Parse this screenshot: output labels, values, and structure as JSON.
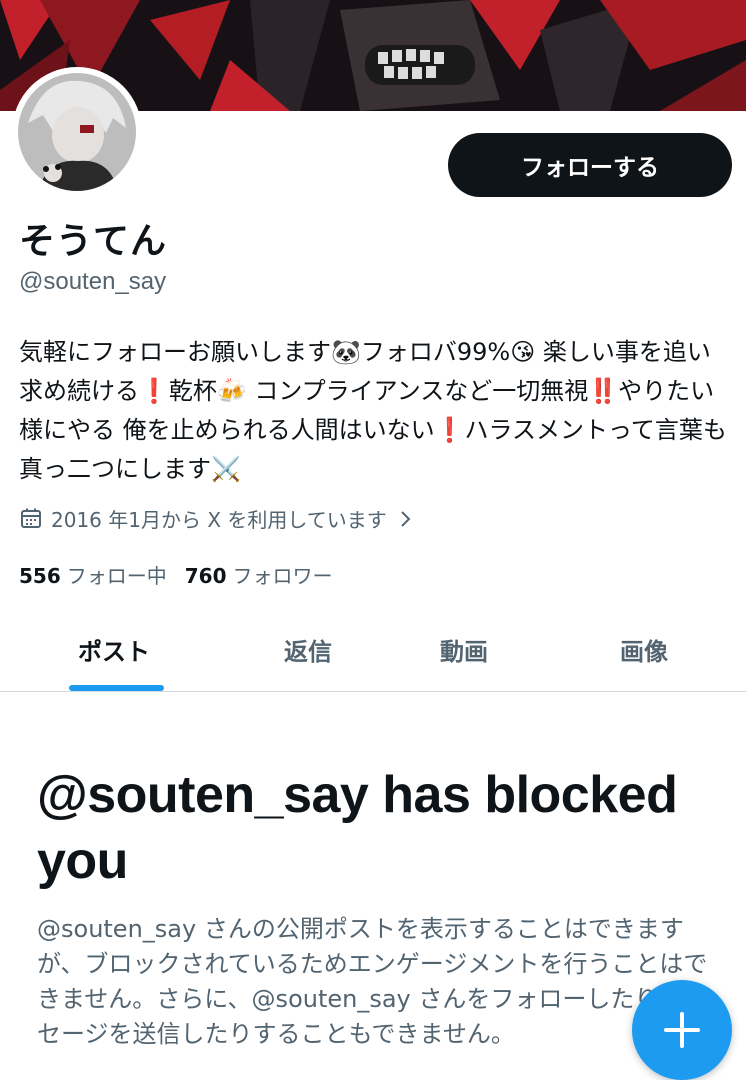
{
  "profile": {
    "display_name": "そうてん",
    "handle": "@souten_say",
    "follow_button_label": "フォローする",
    "bio": "気軽にフォローお願いします🐼フォロバ99%😘 楽しい事を追い求め続ける❗️乾杯🍻 コンプライアンスなど一切無視‼️やりたい様にやる 俺を止められる人間はいない❗️ハラスメントって言葉も真っ二つにします⚔️",
    "joined": "2016 年1月から X を利用しています",
    "following_count": "556",
    "following_label": "フォロー中",
    "followers_count": "760",
    "followers_label": "フォロワー"
  },
  "tabs": [
    {
      "label": "ポスト",
      "active": true
    },
    {
      "label": "返信",
      "active": false
    },
    {
      "label": "動画",
      "active": false
    },
    {
      "label": "画像",
      "active": false
    }
  ],
  "blocked": {
    "title": "@souten_say has blocked you",
    "description": "@souten_say さんの公開ポストを表示することはできますが、ブロックされているためエンゲージメントを行うことはできません。さらに、@souten_say さんをフォローしたりメッセージを送信したりすることもできません。"
  },
  "icons": {
    "calendar": "calendar-icon",
    "chevron": "chevron-right-icon",
    "compose": "plus-icon"
  },
  "colors": {
    "accent": "#1d9bf0",
    "text": "#0f1419",
    "muted": "#536471",
    "follow_button_bg": "#0f1419"
  }
}
